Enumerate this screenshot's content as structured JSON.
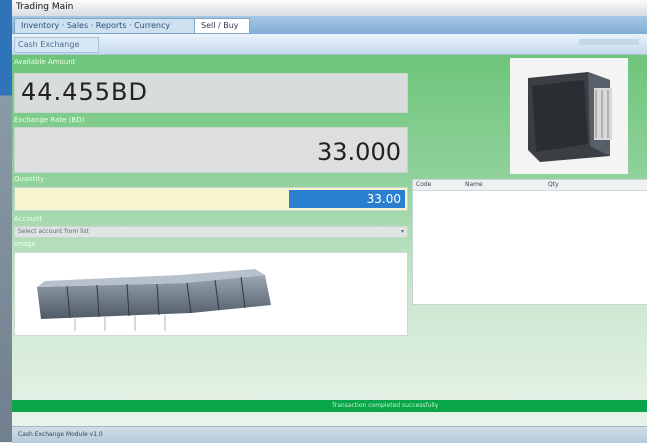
{
  "window": {
    "title": "Trading Main"
  },
  "tabs": [
    {
      "label": "Inventory · Sales · Reports · Currency"
    },
    {
      "label": "Sell / Buy"
    }
  ],
  "subheader": {
    "title": "Cash Exchange"
  },
  "form": {
    "amount_label": "Available Amount",
    "amount_value": "44.455BD",
    "rate_label": "Exchange Rate (BD)",
    "rate_value": "33.000",
    "quantity_label": "Quantity",
    "quantity_value": "33.00",
    "account_label": "Account",
    "account_value": "Select account from list",
    "image_label": "Image"
  },
  "grid": {
    "columns": [
      "Code",
      "Name",
      "Qty"
    ]
  },
  "status": {
    "text": "Transaction completed successfully"
  },
  "bottom": {
    "text": "Cash Exchange Module v1.0"
  },
  "colors": {
    "accent_green": "#0aa548",
    "selection_blue": "#2a7fd1",
    "panel_green": "#6ec57a"
  },
  "icons": {
    "product_image": "folder-icon",
    "tray_image": "tray-icon"
  }
}
